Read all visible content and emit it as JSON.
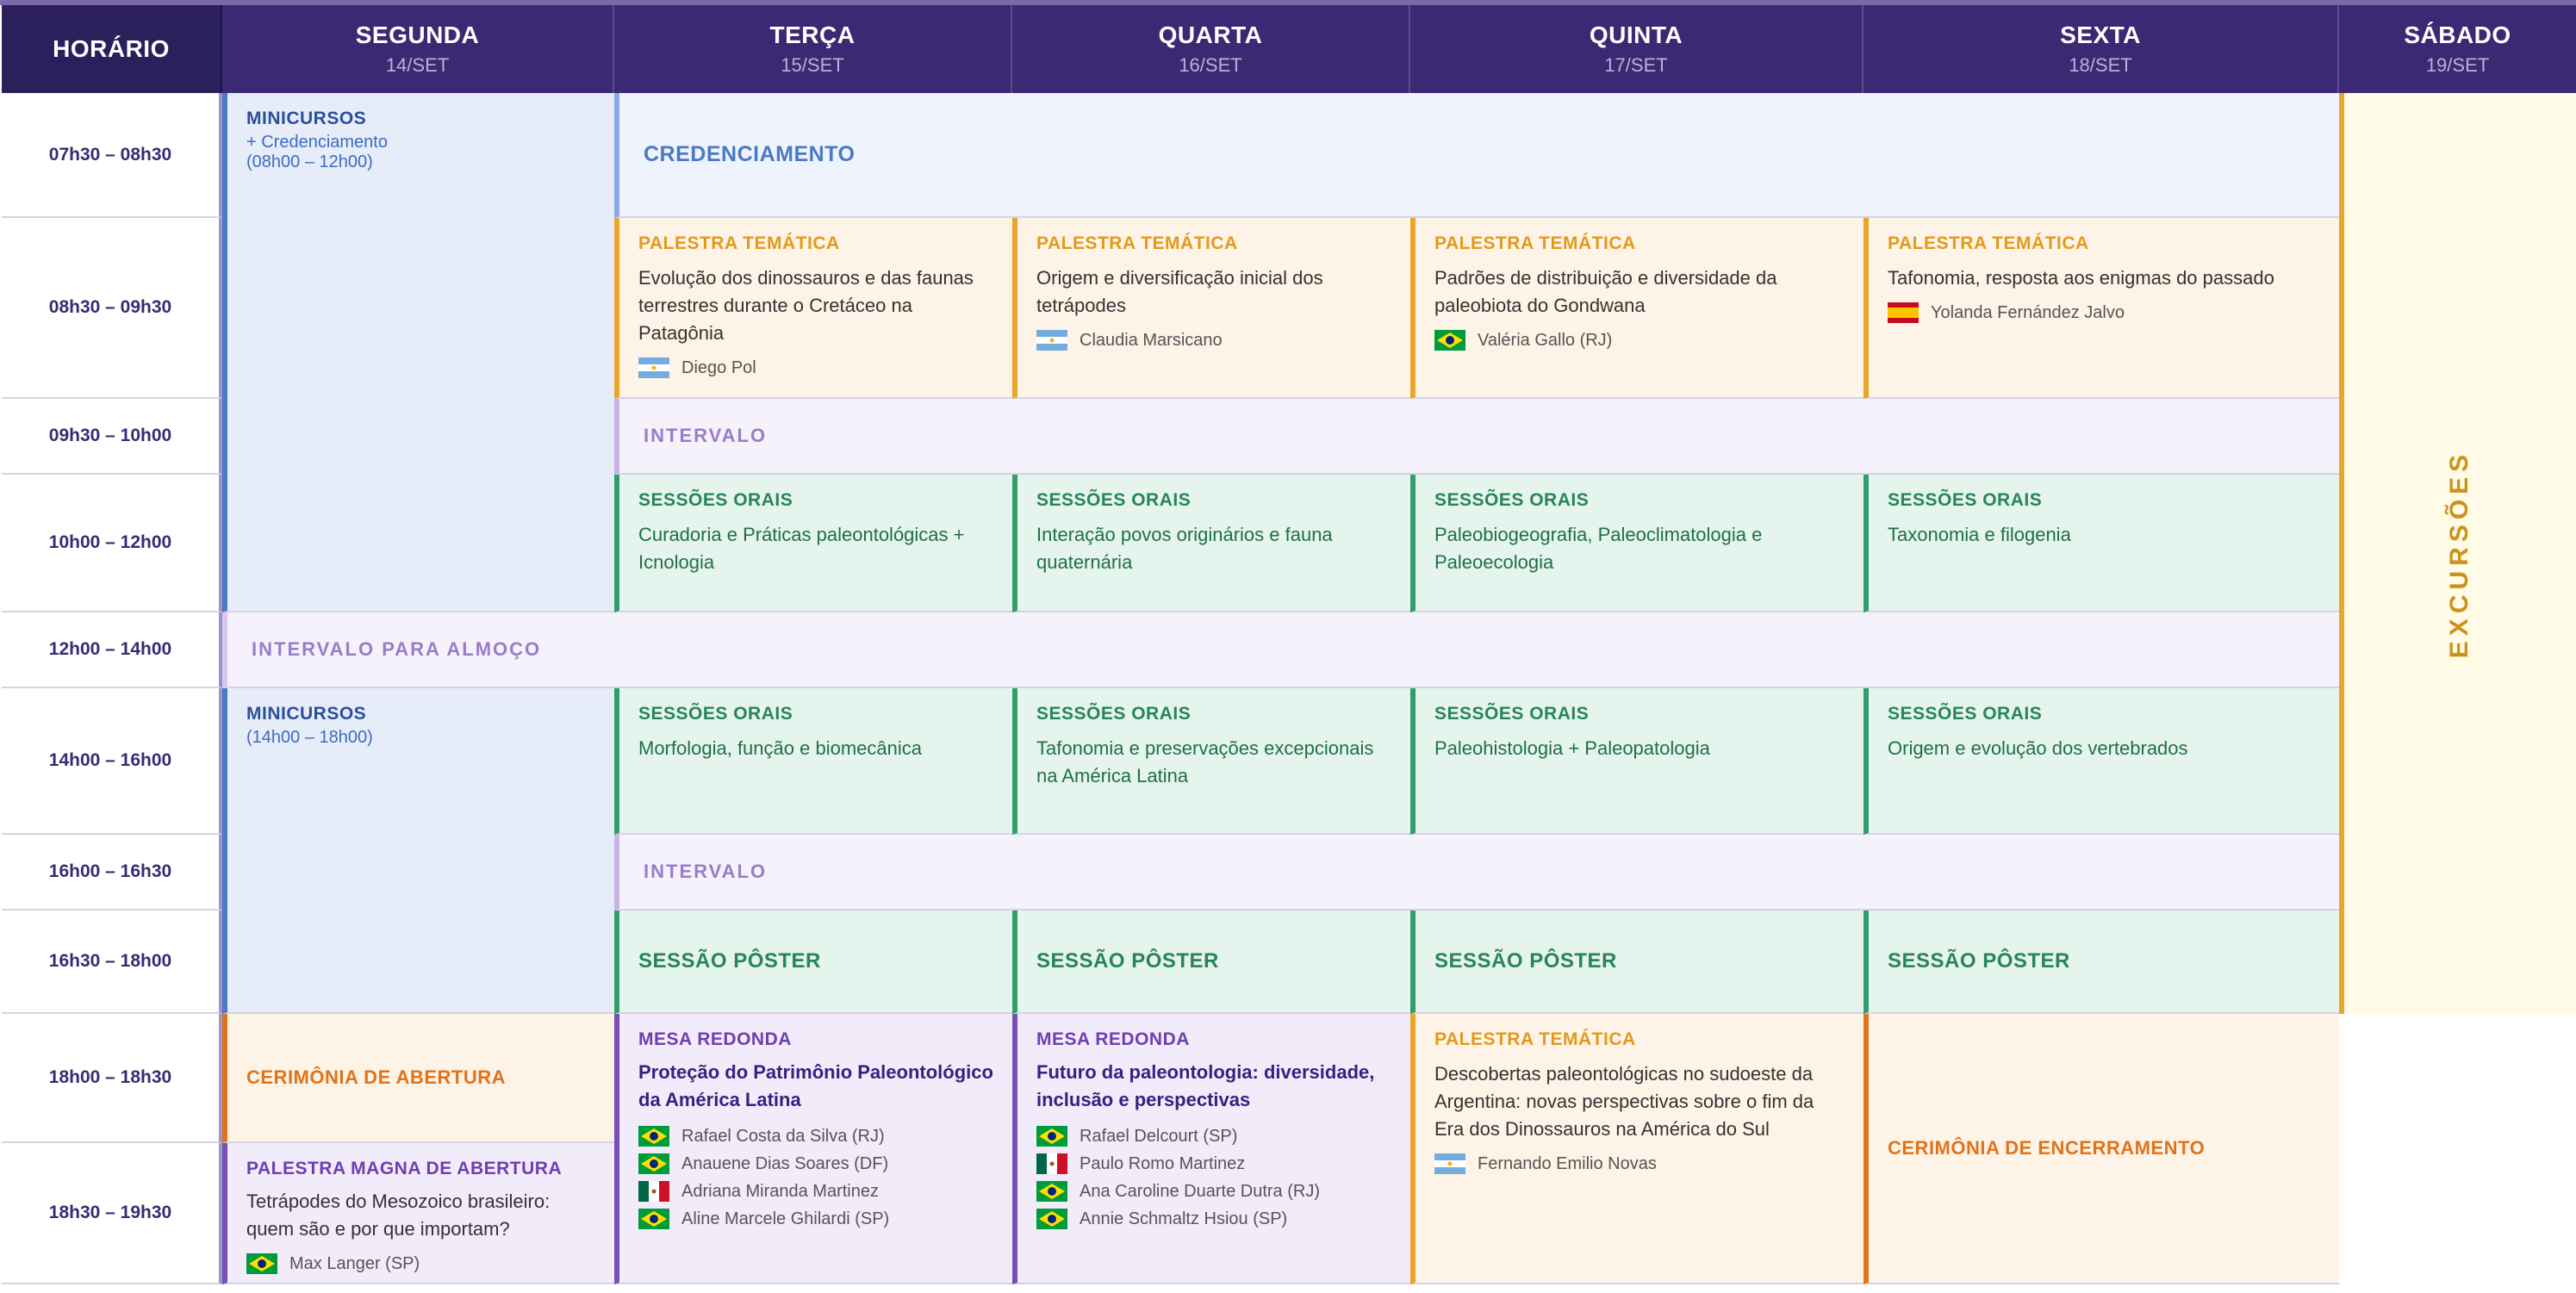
{
  "header": {
    "horario": "HORÁRIO",
    "days": [
      {
        "name": "SEGUNDA",
        "date": "14/SET"
      },
      {
        "name": "TERÇA",
        "date": "15/SET"
      },
      {
        "name": "QUARTA",
        "date": "16/SET"
      },
      {
        "name": "QUINTA",
        "date": "17/SET"
      },
      {
        "name": "SEXTA",
        "date": "18/SET"
      },
      {
        "name": "SÁBADO",
        "date": "19/SET"
      }
    ]
  },
  "times": [
    "07h30 – 08h30",
    "08h30 – 09h30",
    "09h30 – 10h00",
    "10h00 – 12h00",
    "12h00 – 14h00",
    "14h00 – 16h00",
    "16h00 – 16h30",
    "16h30 – 18h00",
    "18h00 – 18h30",
    "18h30 – 19h30"
  ],
  "segunda": {
    "minicursos_morning": {
      "label": "MINICURSOS",
      "line1": "+ Credenciamento",
      "line2": "(08h00 – 12h00)"
    },
    "minicursos_afternoon": {
      "label": "MINICURSOS",
      "line1": "(14h00 – 18h00)"
    },
    "ceremony": "CERIMÔNIA DE ABERTURA",
    "magna": {
      "label": "PALESTRA MAGNA DE ABERTURA",
      "title": "Tetrápodes do Mesozoico brasileiro: quem são e por que importam?",
      "speaker": "Max Langer (SP)"
    }
  },
  "credenciamento": "CREDENCIAMENTO",
  "palestras": [
    {
      "label": "PALESTRA TEMÁTICA",
      "title": "Evolução dos dinossauros e das faunas terrestres durante o Cretáceo na Patagônia",
      "speaker": "Diego Pol"
    },
    {
      "label": "PALESTRA TEMÁTICA",
      "title": "Origem e diversificação inicial dos tetrápodes",
      "speaker": "Claudia Marsicano"
    },
    {
      "label": "PALESTRA TEMÁTICA",
      "title": "Padrões de distribuição e diversidade da paleobiota do Gondwana",
      "speaker": "Valéria Gallo (RJ)"
    },
    {
      "label": "PALESTRA TEMÁTICA",
      "title": "Tafonomia, resposta aos enigmas do passado",
      "speaker": "Yolanda Fernández Jalvo"
    }
  ],
  "intervalo": "INTERVALO",
  "sessoes_manha": [
    {
      "label": "SESSÕES ORAIS",
      "title": "Curadoria e Práticas paleontológicas + Icnologia"
    },
    {
      "label": "SESSÕES ORAIS",
      "title": "Interação povos originários e fauna quaternária"
    },
    {
      "label": "SESSÕES ORAIS",
      "title": "Paleobiogeografia, Paleoclimatologia e Paleoecologia"
    },
    {
      "label": "SESSÕES ORAIS",
      "title": "Taxonomia e filogenia"
    }
  ],
  "almoco": "INTERVALO PARA ALMOÇO",
  "sessoes_tarde": [
    {
      "label": "SESSÕES ORAIS",
      "title": "Morfologia, função e biomecânica"
    },
    {
      "label": "SESSÕES ORAIS",
      "title": "Tafonomia e preservações excepcionais na América Latina"
    },
    {
      "label": "SESSÕES ORAIS",
      "title": "Paleohistologia + Paleopatologia"
    },
    {
      "label": "SESSÕES ORAIS",
      "title": "Origem e evolução dos vertebrados"
    }
  ],
  "poster": "SESSÃO PÔSTER",
  "mesa1": {
    "label": "MESA REDONDA",
    "title": "Proteção do Patrimônio Paleontológico da América Latina",
    "people": [
      "Rafael Costa da Silva (RJ)",
      "Anauene Dias Soares (DF)",
      "Adriana Miranda Martinez",
      "Aline Marcele Ghilardi (SP)"
    ]
  },
  "mesa2": {
    "label": "MESA REDONDA",
    "title": "Futuro da paleontologia: diversidade, inclusão e perspectivas",
    "people": [
      "Rafael Delcourt (SP)",
      "Paulo Romo Martinez",
      "Ana Caroline Duarte Dutra (RJ)",
      "Annie Schmaltz Hsiou (SP)"
    ]
  },
  "quinta_final": {
    "label": "PALESTRA TEMÁTICA",
    "title": "Descobertas paleontológicas no sudoeste da Argentina: novas perspectivas sobre o fim da Era dos Dinossauros na América do Sul",
    "speaker": "Fernando Emilio Novas"
  },
  "encerramento": "CERIMÔNIA DE ENCERRAMENTO",
  "sabado": "EXCURSÕES",
  "colors": {
    "header": "#3b2a73",
    "blue": "#4a7ac6",
    "orange": "#e9a62a",
    "green": "#2f9e6b",
    "purple": "#7650b8",
    "ceremony": "#e0741c"
  },
  "flags": {
    "argentina": "argentina-flag-icon",
    "brazil": "brazil-flag-icon",
    "spain": "spain-flag-icon",
    "mexico": "mexico-flag-icon"
  }
}
